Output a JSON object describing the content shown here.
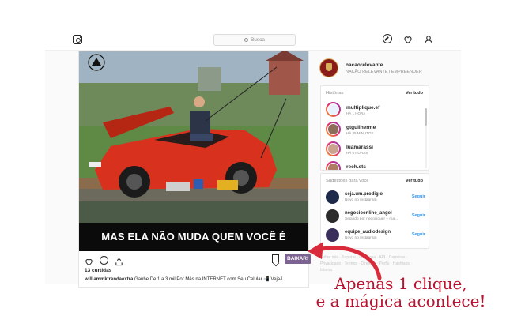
{
  "header": {
    "search_placeholder": "Busca",
    "icons": [
      "instagram-icon",
      "compass-icon",
      "heart-icon",
      "person-icon"
    ]
  },
  "post": {
    "image_caption": "MAS ELA NÃO MUDA QUEM VOCÊ É",
    "plate_text": "",
    "download_label": "BAIXAR!",
    "likes": "13 curtidas",
    "author": "williammktrendaextra",
    "caption_text": " Ganhe De 1 a 3 mil Por Mês na INTERNET com Seu Celular 📲 Vejaჰ"
  },
  "profile": {
    "username": "nacaorelevante",
    "fullname": "NAÇÃO RELEVANTE | EMPREENDER"
  },
  "stories": {
    "title": "Histórias",
    "see_all": "Ver tudo",
    "items": [
      {
        "name": "multiplique.ef",
        "time": "HÁ 1 HORA"
      },
      {
        "name": "gtguilherme",
        "time": "HÁ 35 MINUTOS"
      },
      {
        "name": "luamarassi",
        "time": "HÁ 5 HORAS"
      },
      {
        "name": "reeh.sts",
        "time": ""
      }
    ]
  },
  "suggestions": {
    "title": "Sugestões para você",
    "see_all": "Ver tudo",
    "items": [
      {
        "name": "seja.um.prodigio",
        "sub": "Novo no Instagram",
        "action": "Seguir"
      },
      {
        "name": "negocioonline_angel",
        "sub": "Seguido por negociouer + ma...",
        "action": "Seguir"
      },
      {
        "name": "equipe_audiodesign",
        "sub": "Novo no Instagram",
        "action": "Seguir"
      }
    ]
  },
  "footer": "Sobre nós · Suporte · Imprensa · API · Carreiras · Privacidade · Termos · Diretório · Perfis · Hashtags · Idioma",
  "promo": {
    "line1": "Apenas 1 clique,",
    "line2": "e a mágica acontece!"
  },
  "colors": {
    "baixar_bg": "#7d6391",
    "promo_text": "#b8122f",
    "link_blue": "#3897f0"
  }
}
